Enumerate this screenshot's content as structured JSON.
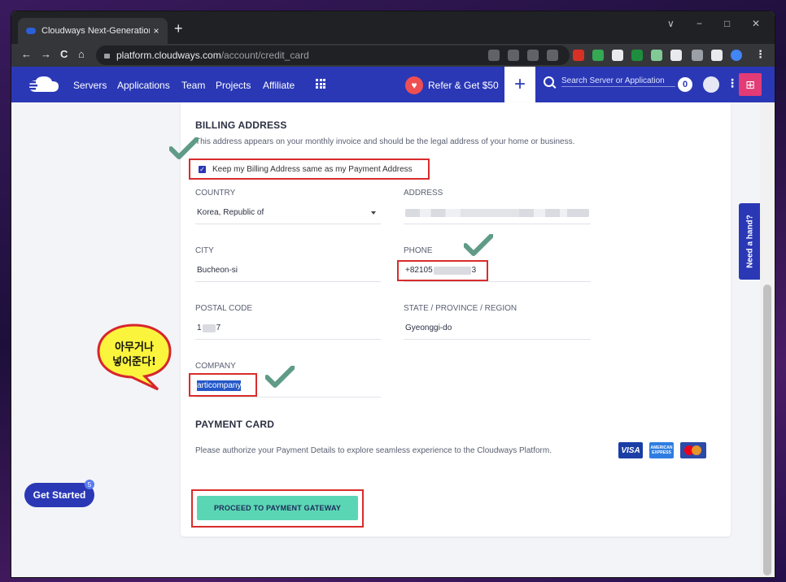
{
  "browser": {
    "tab_title": "Cloudways Next-Generation Clo",
    "tab_close": "×",
    "new_tab": "+",
    "url_host": "platform.cloudways.com",
    "url_path": "/account/credit_card",
    "window_controls": {
      "dropdown": "∨",
      "minimize": "−",
      "maximize": "□",
      "close": "✕"
    },
    "nav": {
      "back": "←",
      "forward": "→",
      "reload": "C",
      "home": "⌂"
    }
  },
  "appbar": {
    "nav_items": [
      "Servers",
      "Applications",
      "Team",
      "Projects",
      "Affiliate"
    ],
    "refer_label": "Refer & Get $50",
    "plus_label": "+",
    "search_placeholder": "Search Server or Application",
    "notification_count": "0",
    "more": "⋮",
    "gift": "⊞"
  },
  "billing": {
    "title": "BILLING ADDRESS",
    "description": "This address appears on your monthly invoice and should be the legal address of your home or business.",
    "same_address_label": "Keep my Billing Address same as my Payment Address",
    "same_address_checked": true,
    "country_label": "COUNTRY",
    "country_value": "Korea, Republic of",
    "address_label": "ADDRESS",
    "city_label": "CITY",
    "city_value": "Bucheon-si",
    "phone_label": "PHONE",
    "phone_prefix": "+82105",
    "phone_suffix": "3",
    "postal_label": "POSTAL CODE",
    "postal_prefix": "1",
    "postal_suffix": "7",
    "state_label": "STATE / PROVINCE / REGION",
    "state_value": "Gyeonggi-do",
    "company_label": "COMPANY",
    "company_value": "articompany"
  },
  "payment": {
    "title": "PAYMENT CARD",
    "description": "Please authorize your Payment Details to explore seamless experience to the Cloudways Platform.",
    "visa_label": "VISA",
    "amex_line1": "AMERICAN",
    "amex_line2": "EXPRESS",
    "proceed_label": "PROCEED TO PAYMENT GATEWAY"
  },
  "help_tab": "Need a hand?",
  "get_started": {
    "label": "Get Started",
    "badge": "5"
  },
  "annotation": {
    "line1": "아무거나",
    "line2": "넣어준다!"
  },
  "colors": {
    "brand": "#2a38b6",
    "proceed": "#5bd6b4",
    "highlight": "#d92c2c",
    "check": "#5f9b86"
  }
}
